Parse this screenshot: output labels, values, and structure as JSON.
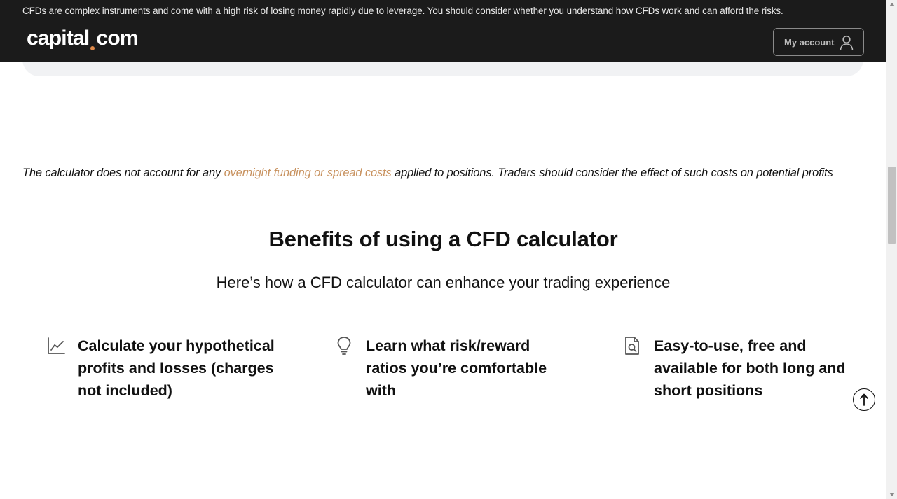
{
  "header": {
    "risk_warning": "CFDs are complex instruments and come with a high risk of losing money rapidly due to leverage. You should consider whether you understand how CFDs work and can afford the risks.",
    "logo_left": "capital",
    "logo_right": "com",
    "account_label": "My account"
  },
  "disclaimer": {
    "before": "The calculator does not account for any ",
    "link": "overnight funding or spread costs",
    "after": " applied to positions. Traders should consider the effect of such costs on potential profits"
  },
  "benefits": {
    "title": "Benefits of using a CFD calculator",
    "subtitle": "Here’s how a CFD calculator can enhance your trading experience",
    "items": [
      {
        "icon": "chart-line-icon",
        "text": "Calculate your hypothetical profits and losses (charges not included)"
      },
      {
        "icon": "lightbulb-icon",
        "text": "Learn what risk/reward ratios you’re comfortable with"
      },
      {
        "icon": "document-search-icon",
        "text": "Easy-to-use, free and available for both long and short positions"
      }
    ]
  },
  "colors": {
    "header_bg": "#1b1b1b",
    "accent_link": "#c8925f",
    "logo_dot": "#e08a4a"
  }
}
